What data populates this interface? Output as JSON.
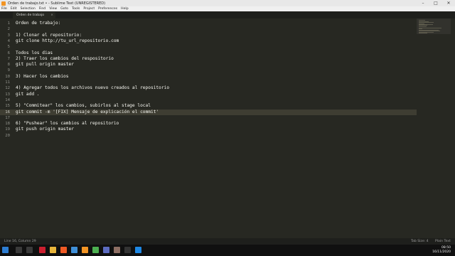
{
  "window": {
    "title": "Orden de trabajo.txt • - Sublime Text (UNREGISTERED)",
    "minimize": "–",
    "maximize": "□",
    "close": "✕"
  },
  "menu": [
    "File",
    "Edit",
    "Selection",
    "Find",
    "View",
    "Goto",
    "Tools",
    "Project",
    "Preferences",
    "Help"
  ],
  "tab": {
    "label": "Orden de trabajo",
    "close": "×"
  },
  "editor": {
    "current_line": 16,
    "lines": [
      "Orden de trabajo:",
      "",
      "1) Clonar el repositorio:",
      "git clone http://tu_url_repositorio.com",
      "",
      "Todos los dias",
      "2) Traer los cambios del respositorio",
      "git pull origin master",
      "",
      "3) Hacer los cambios",
      "",
      "4) Agregar todos los archivos nuevo creados al repositorio",
      "git add .",
      "",
      "5) \"Commitear\" los cambios, subirlos al stage local",
      "git commit -m '[FIX] Mensaje de explicación el commit'",
      "",
      "6) \"Pushear\" los cambios al repositorio",
      "git push origin master",
      ""
    ]
  },
  "status": {
    "position": "Line 16, Column 29",
    "tab_size": "Tab Size: 4",
    "syntax": "Plain Text"
  },
  "taskbar": {
    "time": "08:50",
    "date": "16/11/2020",
    "icons": [
      {
        "name": "windows-start-icon",
        "color": "#2d7dd2"
      },
      {
        "name": "search-icon",
        "color": "#3a3a3a"
      },
      {
        "name": "task-view-icon",
        "color": "#3a3a3a"
      },
      {
        "name": "opera-icon",
        "color": "#cc1f2f"
      },
      {
        "name": "folder-icon",
        "color": "#e8b53b"
      },
      {
        "name": "brave-icon",
        "color": "#f05a24"
      },
      {
        "name": "files-icon",
        "color": "#3f8fd8"
      },
      {
        "name": "sublime-text-icon",
        "color": "#f29424"
      },
      {
        "name": "chrome-icon",
        "color": "#4caf50"
      },
      {
        "name": "app-icon",
        "color": "#5c6bc0"
      },
      {
        "name": "app-icon-2",
        "color": "#8d6e63"
      },
      {
        "name": "terminal-icon",
        "color": "#333333"
      },
      {
        "name": "vscode-icon",
        "color": "#1e88e5"
      }
    ]
  }
}
